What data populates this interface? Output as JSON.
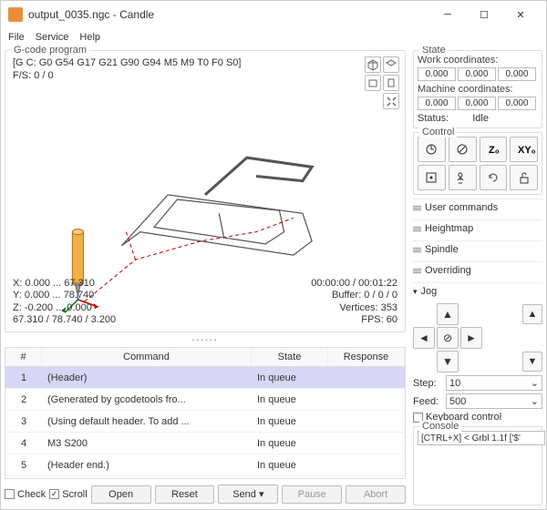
{
  "window": {
    "title": "output_0035.ngc - Candle"
  },
  "menu": {
    "file": "File",
    "service": "Service",
    "help": "Help"
  },
  "visualizer": {
    "title": "G-code program",
    "gcode_header": "[G C: G0 G54 G17 G21 G90 G94 M5 M9 T0 F0 S0]",
    "fs": "F/S: 0 / 0",
    "x": "X: 0.000 ... 67.310",
    "y": "Y: 0.000 ... 78.740",
    "z": "Z: -0.200 ... 0.000",
    "dim": "67.310 / 78.740 / 3.200",
    "time": "00:00:00 / 00:01:22",
    "buffer": "Buffer: 0 / 0 / 0",
    "vertices": "Vertices: 353",
    "fps": "FPS: 60"
  },
  "table": {
    "headers": {
      "n": "#",
      "cmd": "Command",
      "state": "State",
      "resp": "Response"
    },
    "rows": [
      {
        "n": "1",
        "cmd": "(Header)",
        "state": "In queue",
        "resp": ""
      },
      {
        "n": "2",
        "cmd": "(Generated by gcodetools fro...",
        "state": "In queue",
        "resp": ""
      },
      {
        "n": "3",
        "cmd": "(Using default header. To add ...",
        "state": "In queue",
        "resp": ""
      },
      {
        "n": "4",
        "cmd": "M3 S200",
        "state": "In queue",
        "resp": ""
      },
      {
        "n": "5",
        "cmd": "(Header end.)",
        "state": "In queue",
        "resp": ""
      }
    ]
  },
  "bottom": {
    "check": "Check",
    "scroll": "Scroll",
    "open": "Open",
    "reset": "Reset",
    "send": "Send",
    "pause": "Pause",
    "abort": "Abort"
  },
  "state": {
    "title": "State",
    "work": "Work coordinates:",
    "machine": "Machine coordinates:",
    "coords": [
      "0.000",
      "0.000",
      "0.000"
    ],
    "mcoords": [
      "0.000",
      "0.000",
      "0.000"
    ],
    "status_lbl": "Status:",
    "status_val": "Idle"
  },
  "control": {
    "title": "Control"
  },
  "sections": {
    "user": "User commands",
    "height": "Heightmap",
    "spindle": "Spindle",
    "override": "Overriding",
    "jog": "Jog"
  },
  "jog": {
    "step_lbl": "Step:",
    "step_val": "10",
    "feed_lbl": "Feed:",
    "feed_val": "500",
    "kb": "Keyboard control"
  },
  "console": {
    "title": "Console",
    "text": "[CTRL+X] < Grbl 1.1f ['$'"
  }
}
